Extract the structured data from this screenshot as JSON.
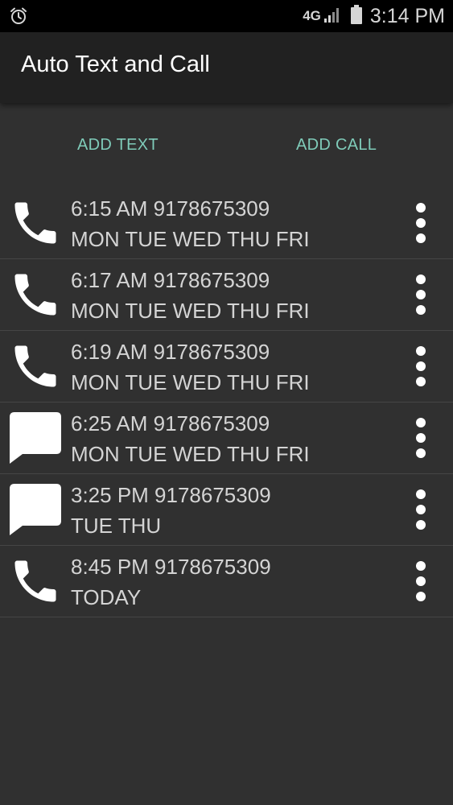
{
  "status_bar": {
    "network": "4G",
    "time": "3:14 PM",
    "icons": [
      "alarm-icon",
      "signal-icon",
      "battery-icon"
    ]
  },
  "app_bar": {
    "title": "Auto Text and Call"
  },
  "actions": {
    "add_text": "ADD TEXT",
    "add_call": "ADD CALL"
  },
  "colors": {
    "accent": "#7fcbb9",
    "background": "#303030",
    "app_bar": "#212121",
    "status_bar": "#000000",
    "text": "#d4d4d4"
  },
  "items": [
    {
      "type": "call",
      "icon": "phone-icon",
      "time_number": "6:15 AM 9178675309",
      "days": "MON TUE WED THU FRI"
    },
    {
      "type": "call",
      "icon": "phone-icon",
      "time_number": "6:17 AM 9178675309",
      "days": "MON TUE WED THU FRI"
    },
    {
      "type": "call",
      "icon": "phone-icon",
      "time_number": "6:19 AM 9178675309",
      "days": "MON TUE WED THU FRI"
    },
    {
      "type": "text",
      "icon": "message-icon",
      "time_number": "6:25 AM 9178675309",
      "days": "MON TUE WED THU FRI"
    },
    {
      "type": "text",
      "icon": "message-icon",
      "time_number": "3:25 PM 9178675309",
      "days": "TUE THU"
    },
    {
      "type": "call",
      "icon": "phone-icon",
      "time_number": "8:45 PM 9178675309",
      "days": "TODAY"
    }
  ]
}
